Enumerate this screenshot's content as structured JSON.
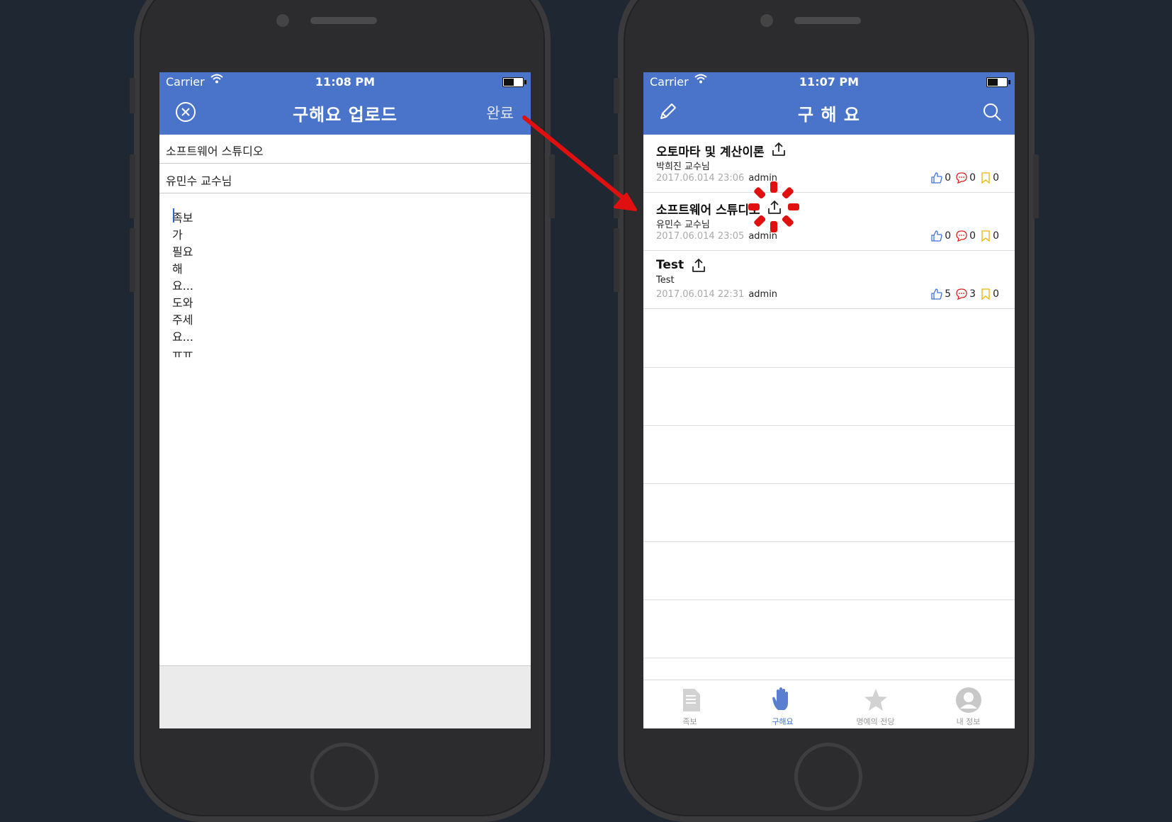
{
  "left_screen": {
    "status": {
      "carrier": "Carrier",
      "time": "11:08 PM"
    },
    "nav": {
      "title": "구해요 업로드",
      "done_label": "완료",
      "close_icon": "close-circle-icon"
    },
    "form": {
      "title_value": "소프트웨어 스튜디오",
      "professor_value": "유민수 교수님",
      "body_value": "족보가 필요해요... 도와주세요...ㅠㅠ"
    }
  },
  "right_screen": {
    "status": {
      "carrier": "Carrier",
      "time": "11:07 PM"
    },
    "nav": {
      "title": "구 해 요",
      "left_icon": "pencil-icon",
      "right_icon": "search-icon"
    },
    "posts": [
      {
        "title": "오토마타 및 계산이론",
        "professor": "박희진 교수님",
        "date": "2017.06.014 23:06",
        "author": "admin",
        "likes": "0",
        "comments": "0",
        "bookmarks": "0"
      },
      {
        "title": "소프트웨어 스튜디오",
        "professor": "유민수 교수님",
        "date": "2017.06.014 23:05",
        "author": "admin",
        "likes": "0",
        "comments": "0",
        "bookmarks": "0"
      },
      {
        "title": "Test",
        "professor": "Test",
        "date": "2017.06.014 22:31",
        "author": "admin",
        "likes": "5",
        "comments": "3",
        "bookmarks": "0"
      }
    ],
    "tabs": [
      {
        "label": "족보",
        "icon": "document-icon"
      },
      {
        "label": "구해요",
        "icon": "hand-icon",
        "active": true
      },
      {
        "label": "명예의 전당",
        "icon": "star-icon"
      },
      {
        "label": "내 정보",
        "icon": "profile-icon"
      }
    ]
  },
  "colors": {
    "nav_blue": "#4a74c9",
    "annotation_red": "#e01010",
    "active_tab": "#3e73d8"
  }
}
